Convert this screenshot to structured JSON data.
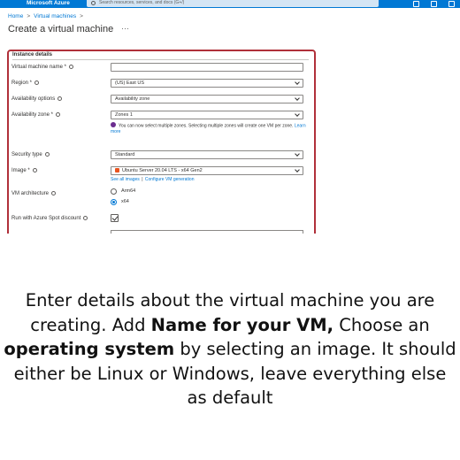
{
  "topbar": {
    "brand": "Microsoft Azure",
    "search_placeholder": "Search resources, services, and docs (G+/)",
    "accent_color": "#0078d4"
  },
  "breadcrumb": {
    "home": "Home",
    "virtual_machines": "Virtual machines"
  },
  "page": {
    "title": "Create a virtual machine",
    "more": "···"
  },
  "form": {
    "section": "Instance details",
    "vm_name": {
      "label": "Virtual machine name *",
      "value": ""
    },
    "region": {
      "label": "Region *",
      "value": "(US) East US"
    },
    "availability_options": {
      "label": "Availability options",
      "value": "Availability zone"
    },
    "availability_zone": {
      "label": "Availability zone *",
      "value": "Zones 1",
      "note": "You can now select multiple zones. Selecting multiple zones will create one VM per zone.",
      "note_link": "Learn more"
    },
    "security_type": {
      "label": "Security type",
      "value": "Standard"
    },
    "image": {
      "label": "Image *",
      "value": "Ubuntu Server 20.04 LTS - x64 Gen2",
      "link_all": "See all images",
      "link_sep": "|",
      "link_config": "Configure VM generation"
    },
    "vm_architecture": {
      "label": "VM architecture",
      "options": [
        "Arm64",
        "x64"
      ],
      "selected": "x64"
    },
    "spot": {
      "label": "Run with Azure Spot discount",
      "checked": true
    }
  },
  "caption": {
    "line1": "Enter details about the virtual machine you are",
    "line2_a": "creating.  Add ",
    "line2_b": "Name for your VM,",
    "line2_c": " Choose an",
    "line3_a": "operating system",
    "line3_b": " by selecting an image. It should",
    "line4": "either be  Linux or Windows, leave everything else",
    "line5": "as default"
  }
}
